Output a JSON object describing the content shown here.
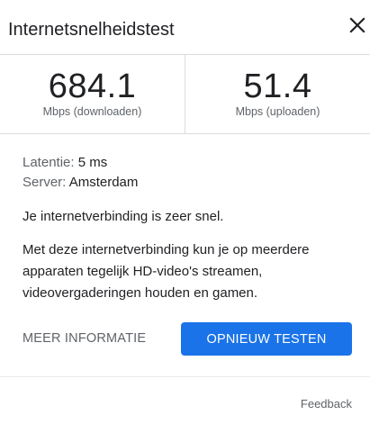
{
  "dialog": {
    "title": "Internetsnelheidstest",
    "close_icon": "close-icon"
  },
  "results": {
    "download": {
      "value": "684.1",
      "unit": "Mbps (downloaden)"
    },
    "upload": {
      "value": "51.4",
      "unit": "Mbps (uploaden)"
    }
  },
  "details": {
    "latency_label": "Latentie:",
    "latency_value": "5 ms",
    "server_label": "Server:",
    "server_value": "Amsterdam"
  },
  "messages": {
    "status": "Je internetverbinding is zeer snel.",
    "description": "Met deze internetverbinding kun je op meerdere apparaten tegelijk HD-video's streamen, videovergaderingen houden en gamen."
  },
  "actions": {
    "more_info_label": "MEER INFORMATIE",
    "retest_label": "OPNIEUW TESTEN"
  },
  "footer": {
    "feedback_label": "Feedback"
  },
  "colors": {
    "accent": "#1a73e8",
    "text_primary": "#202124",
    "text_secondary": "#5f6368",
    "divider": "#dadce0"
  }
}
